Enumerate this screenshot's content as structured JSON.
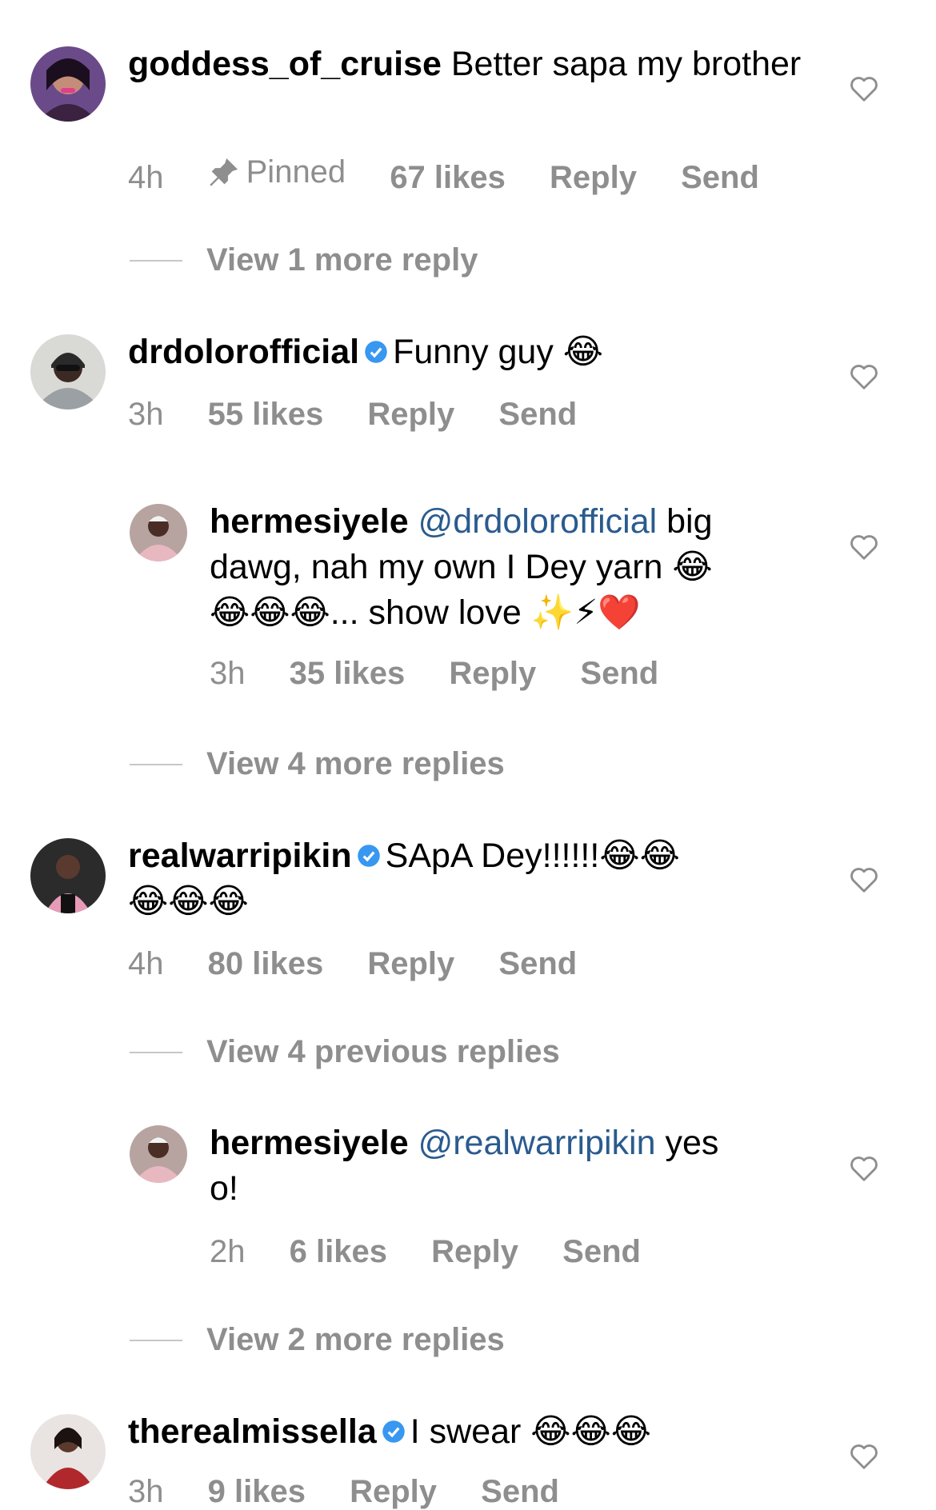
{
  "comments": [
    {
      "username": "goddess_of_cruise",
      "text": "Better sapa my brother",
      "time": "4h",
      "pinned_label": "Pinned",
      "likes": "67 likes",
      "reply": "Reply",
      "send": "Send",
      "view_more": "View 1 more reply"
    },
    {
      "username": "drdolorofficial",
      "text": "Funny guy 😂",
      "time": "3h",
      "likes": "55 likes",
      "reply": "Reply",
      "send": "Send"
    },
    {
      "username": "hermesiyele",
      "mention": "@drdolorofficial",
      "text_line1": "big",
      "text_line2": "dawg, nah my own I Dey yarn 😂",
      "text_line3": "😂😂😂... show love ✨⚡❤️",
      "time": "3h",
      "likes": "35 likes",
      "reply": "Reply",
      "send": "Send",
      "view_more": "View 4 more replies"
    },
    {
      "username": "realwarripikin",
      "text_line1": "SApA Dey!!!!!!😂😂",
      "text_line2": "😂😂😂",
      "time": "4h",
      "likes": "80 likes",
      "reply": "Reply",
      "send": "Send",
      "view_more": "View 4 previous replies"
    },
    {
      "username": "hermesiyele",
      "mention": "@realwarripikin",
      "text_line1": "yes",
      "text_line2": "o!",
      "time": "2h",
      "likes": "6 likes",
      "reply": "Reply",
      "send": "Send",
      "view_more": "View 2 more replies"
    },
    {
      "username": "therealmissella",
      "text": "I swear 😂😂😂",
      "time": "3h",
      "likes": "9 likes",
      "reply": "Reply",
      "send": "Send"
    }
  ],
  "colors": {
    "meta": "#8e8e8e",
    "mention": "#2a5b8e",
    "verified": "#3897f0"
  },
  "icons": {
    "like": "heart-icon",
    "pin": "pin-icon",
    "verified": "verified-badge-icon"
  }
}
